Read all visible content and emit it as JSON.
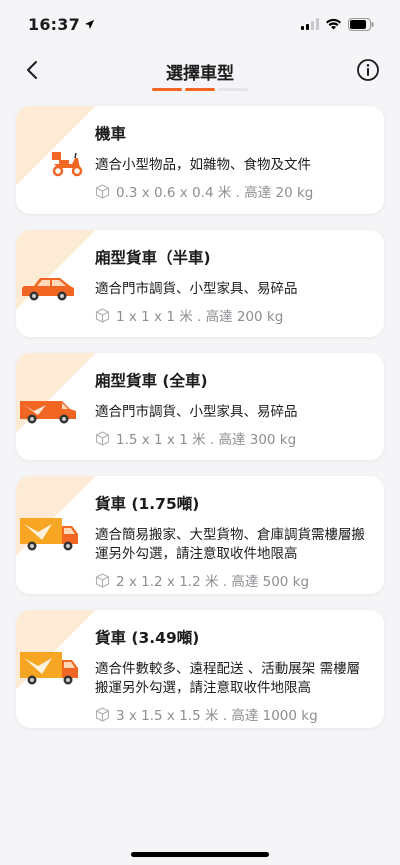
{
  "status": {
    "time": "16:37"
  },
  "header": {
    "title": "選擇車型"
  },
  "progress": {
    "steps_total": 3,
    "steps_active": 2
  },
  "colors": {
    "accent": "#f16622",
    "corner": "#fdebd6"
  },
  "vehicles": [
    {
      "name": "機車",
      "desc": "適合小型物品，如雜物、食物及文件",
      "spec": "0.3 x 0.6 x 0.4 米 . 高達 20 kg",
      "icon": "motorcycle-icon"
    },
    {
      "name": "廂型貨車（半車)",
      "desc": "適合門市調貨、小型家具、易碎品",
      "spec": "1 x 1 x 1 米 . 高達 200 kg",
      "icon": "car-icon"
    },
    {
      "name": "廂型貨車 (全車)",
      "desc": "適合門市調貨、小型家具、易碎品",
      "spec": "1.5 x 1 x 1 米 . 高達 300 kg",
      "icon": "van-icon"
    },
    {
      "name": "貨車 (1.75噸)",
      "desc": "適合簡易搬家、大型貨物、倉庫調貨需樓層搬運另外勾選，請注意取收件地限高",
      "spec": "2 x 1.2 x 1.2 米 . 高達 500 kg",
      "icon": "truck-icon"
    },
    {
      "name": "貨車 (3.49噸)",
      "desc": "適合件數較多、遠程配送 、活動展架 需樓層搬運另外勾選，請注意取收件地限高",
      "spec": "3 x 1.5 x 1.5 米 . 高達 1000 kg",
      "icon": "truck-large-icon"
    }
  ]
}
